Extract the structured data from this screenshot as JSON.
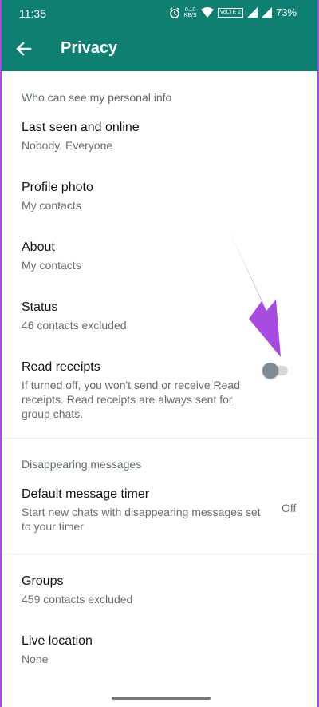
{
  "status_bar": {
    "time": "11:35",
    "data_speed": "0.10",
    "data_unit": "KB/S",
    "network_badge": "VoLTE 2",
    "battery": "73%"
  },
  "app_bar": {
    "title": "Privacy"
  },
  "sections": {
    "personal_info_header": "Who can see my personal info",
    "disappearing_header": "Disappearing messages"
  },
  "items": {
    "last_seen": {
      "title": "Last seen and online",
      "value": "Nobody, Everyone"
    },
    "profile_photo": {
      "title": "Profile photo",
      "value": "My contacts"
    },
    "about": {
      "title": "About",
      "value": "My contacts"
    },
    "status": {
      "title": "Status",
      "value": "46 contacts excluded"
    },
    "read_receipts": {
      "title": "Read receipts",
      "description_1": "If turned off, you won't send or receive Read",
      "description_2": "receipts. Read receipts are always sent for",
      "description_3": "group chats.",
      "enabled": false
    },
    "default_timer": {
      "title": "Default message timer",
      "description_1": "Start new chats with disappearing messages set",
      "description_2": "to your timer",
      "value": "Off"
    },
    "groups": {
      "title": "Groups",
      "value": "459 contacts excluded"
    },
    "live_location": {
      "title": "Live location",
      "value": "None"
    }
  },
  "colors": {
    "header_bg": "#0e7f70",
    "annotation_arrow": "#a64ce0"
  }
}
